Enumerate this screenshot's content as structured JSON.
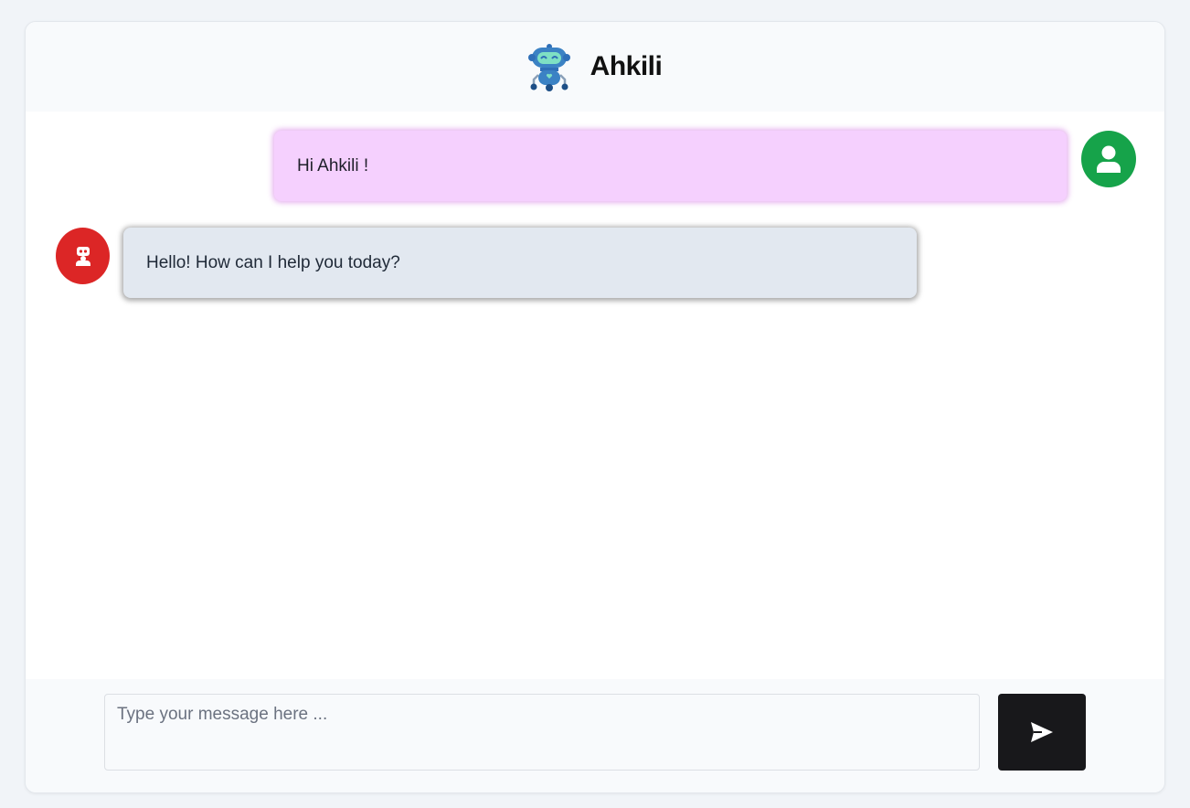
{
  "app": {
    "title": "Ahkili",
    "logo_icon": "robot-logo-icon"
  },
  "messages": [
    {
      "sender": "user",
      "text": "Hi Ahkili !",
      "avatar_icon": "user-icon",
      "avatar_color": "#16a34a",
      "bubble_color": "#f5d0fe"
    },
    {
      "sender": "bot",
      "text": "Hello! How can I help you today?",
      "avatar_icon": "robot-icon",
      "avatar_color": "#dc2626",
      "bubble_color": "#e2e8f0"
    }
  ],
  "composer": {
    "placeholder": "Type your message here ...",
    "value": "",
    "send_icon": "send-icon",
    "send_color": "#18181b"
  }
}
